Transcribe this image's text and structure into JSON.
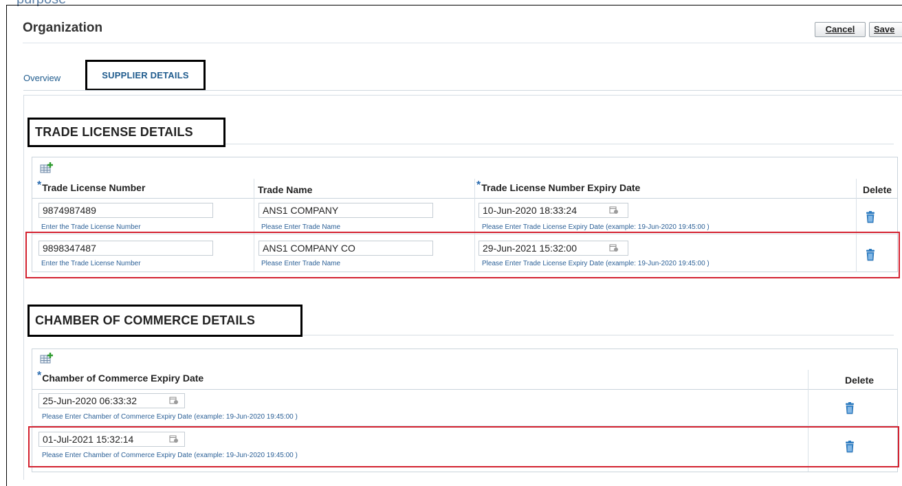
{
  "top_cut_text": "purpose",
  "page": {
    "title": "Organization",
    "cancel_label": "Cancel",
    "save_label": "Save"
  },
  "tabs": [
    {
      "label": "Overview"
    },
    {
      "label": "SUPPLIER DETAILS"
    }
  ],
  "trade_license": {
    "heading": "TRADE LICENSE DETAILS",
    "columns": {
      "number": "Trade License Number",
      "name": "Trade Name",
      "expiry": "Trade License Number Expiry Date",
      "delete": "Delete"
    },
    "rows": [
      {
        "number": "9874987489",
        "number_hint": "Enter the Trade License Number",
        "name": "ANS1 COMPANY",
        "name_hint": "Please Enter Trade Name",
        "expiry": "10-Jun-2020 18:33:24",
        "expiry_hint": "Please Enter Trade License Expiry Date (example: 19-Jun-2020 19:45:00 )"
      },
      {
        "number": "9898347487",
        "number_hint": "Enter the Trade License Number",
        "name": "ANS1 COMPANY CO",
        "name_hint": "Please Enter Trade Name",
        "expiry": "29-Jun-2021 15:32:00",
        "expiry_hint": "Please Enter Trade License Expiry Date (example: 19-Jun-2020 19:45:00 )"
      }
    ]
  },
  "chamber": {
    "heading": "CHAMBER OF COMMERCE DETAILS",
    "columns": {
      "expiry": "Chamber of Commerce Expiry Date",
      "delete": "Delete"
    },
    "rows": [
      {
        "expiry": "25-Jun-2020 06:33:32",
        "expiry_hint": "Please Enter Chamber of Commerce Expiry Date (example: 19-Jun-2020 19:45:00 )"
      },
      {
        "expiry": "01-Jul-2021 15:32:14",
        "expiry_hint": "Please Enter Chamber of Commerce Expiry Date (example: 19-Jun-2020 19:45:00 )"
      }
    ]
  },
  "colors": {
    "link_blue": "#1f5b8d",
    "hint_blue": "#2a5f96",
    "highlight_red": "#d3202e"
  }
}
